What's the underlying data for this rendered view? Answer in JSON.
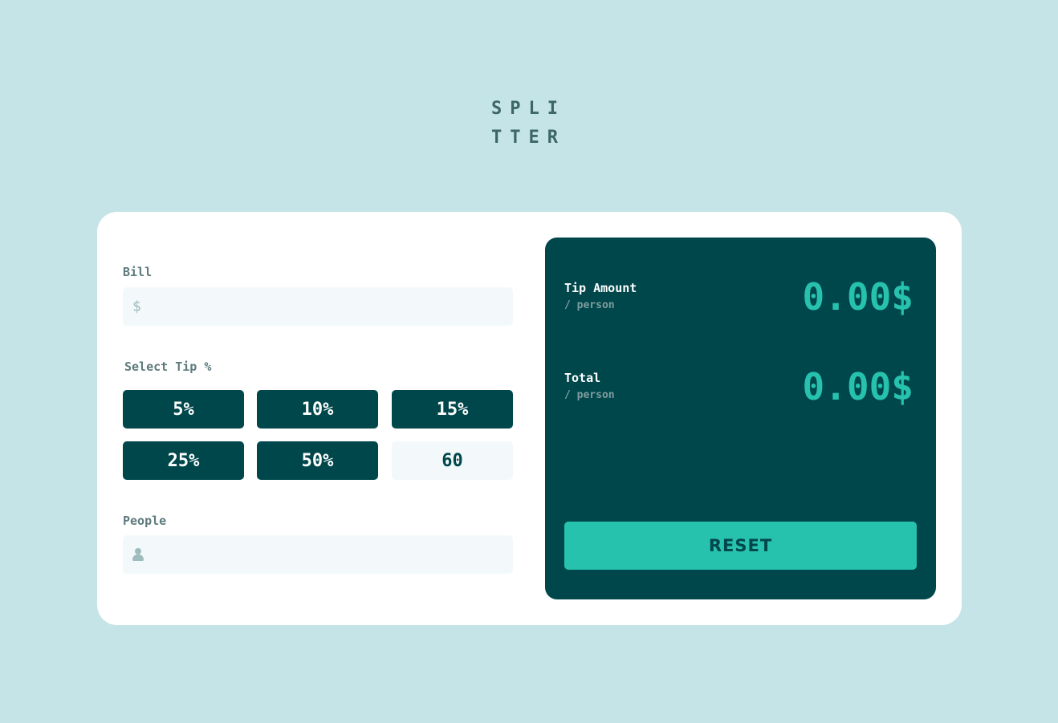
{
  "logo": {
    "line1": "SPLI",
    "line2": "TTER"
  },
  "bill": {
    "label": "Bill",
    "icon": "dollar-icon",
    "currency_symbol": "$",
    "value": ""
  },
  "tip": {
    "label": "Select Tip %",
    "options": [
      "5%",
      "10%",
      "15%",
      "25%",
      "50%"
    ],
    "custom_value": "60"
  },
  "people": {
    "label": "People",
    "icon": "person-icon",
    "value": ""
  },
  "results": {
    "tip_amount": {
      "title": "Tip Amount",
      "sub": "/ person",
      "value": "0.00$"
    },
    "total": {
      "title": "Total",
      "sub": "/ person",
      "value": "0.00$"
    },
    "reset_label": "RESET"
  },
  "colors": {
    "background": "#c5e4e7",
    "dark_cyan": "#00474b",
    "strong_cyan": "#26c2ae",
    "input_bg": "#f3f9fa",
    "label_gray": "#5e7a7d"
  }
}
